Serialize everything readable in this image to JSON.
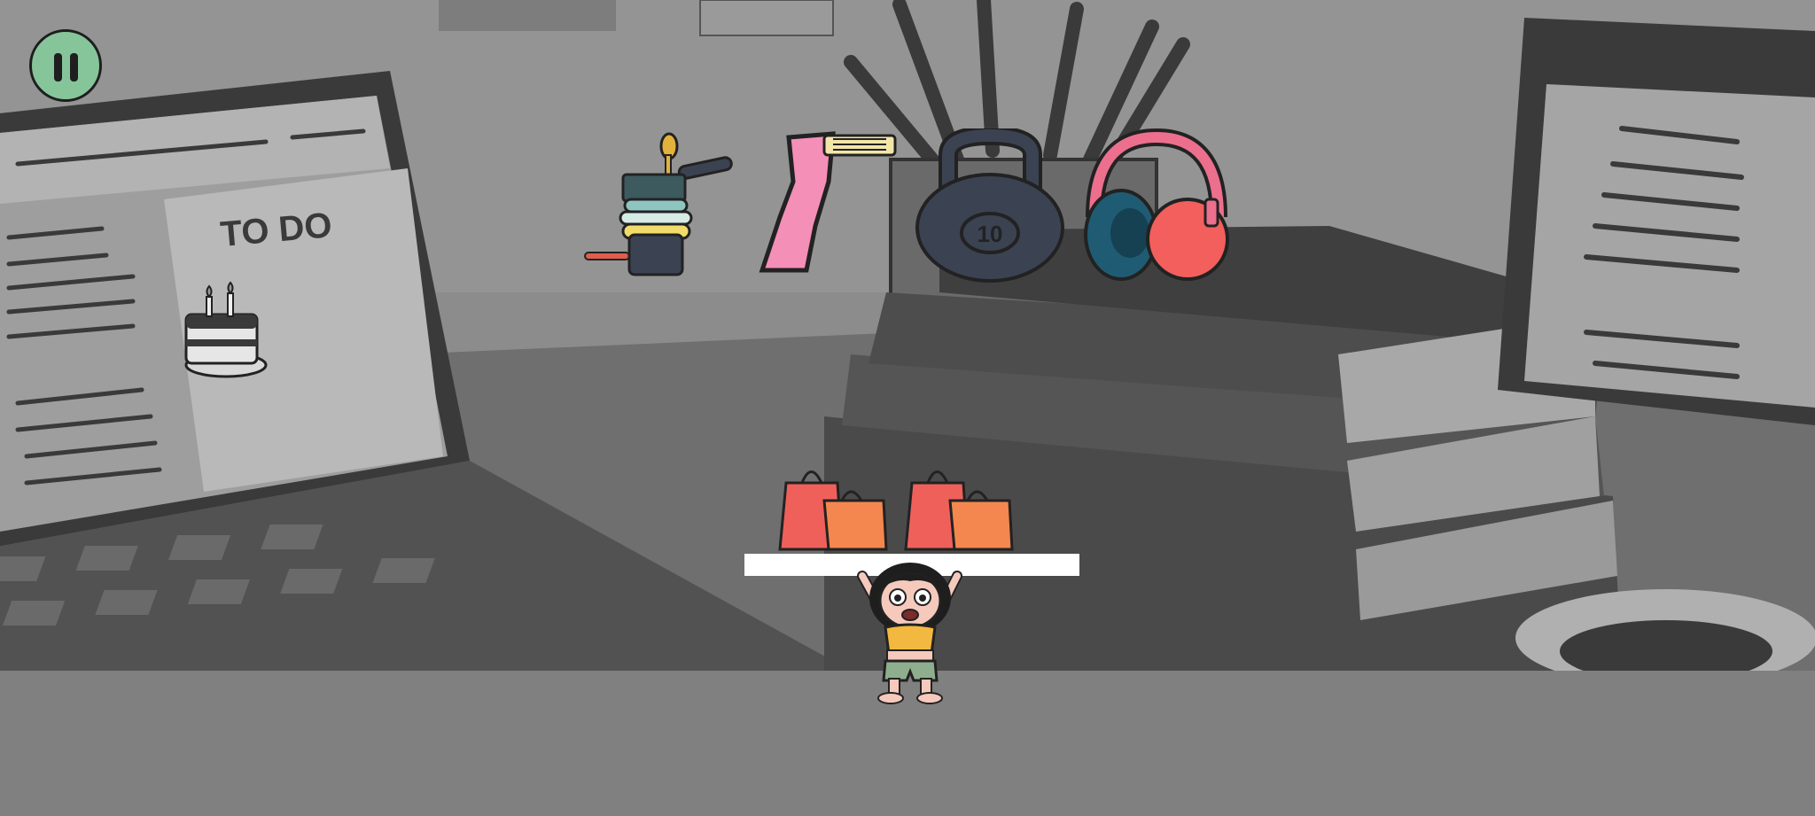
{
  "background": {
    "laptop_screen_text": "TO DO",
    "tone": "#8a8a8a"
  },
  "hud": {
    "pause_icon": "pause-icon",
    "pause_color": "#86c59a"
  },
  "falling_items": [
    {
      "name": "birthday-cake",
      "icon": "cake-icon"
    },
    {
      "name": "pot-and-plates-stack",
      "icon": "cookware-icon"
    },
    {
      "name": "pink-hair-straightener",
      "icon": "straightener-icon"
    },
    {
      "name": "kettlebell",
      "icon": "kettlebell-icon",
      "label": "10"
    },
    {
      "name": "headphones",
      "icon": "headphones-icon"
    }
  ],
  "platform_items": [
    {
      "name": "shopping-bags-left",
      "icon": "shopping-bags-icon"
    },
    {
      "name": "shopping-bags-right",
      "icon": "shopping-bags-icon"
    }
  ],
  "colors": {
    "platform": "#ffffff",
    "floor": "#808080",
    "kettlebell": "#3b4352",
    "headphones": "#f25f5c",
    "straightener": "#f48fb8",
    "bags": "#f0605a"
  }
}
